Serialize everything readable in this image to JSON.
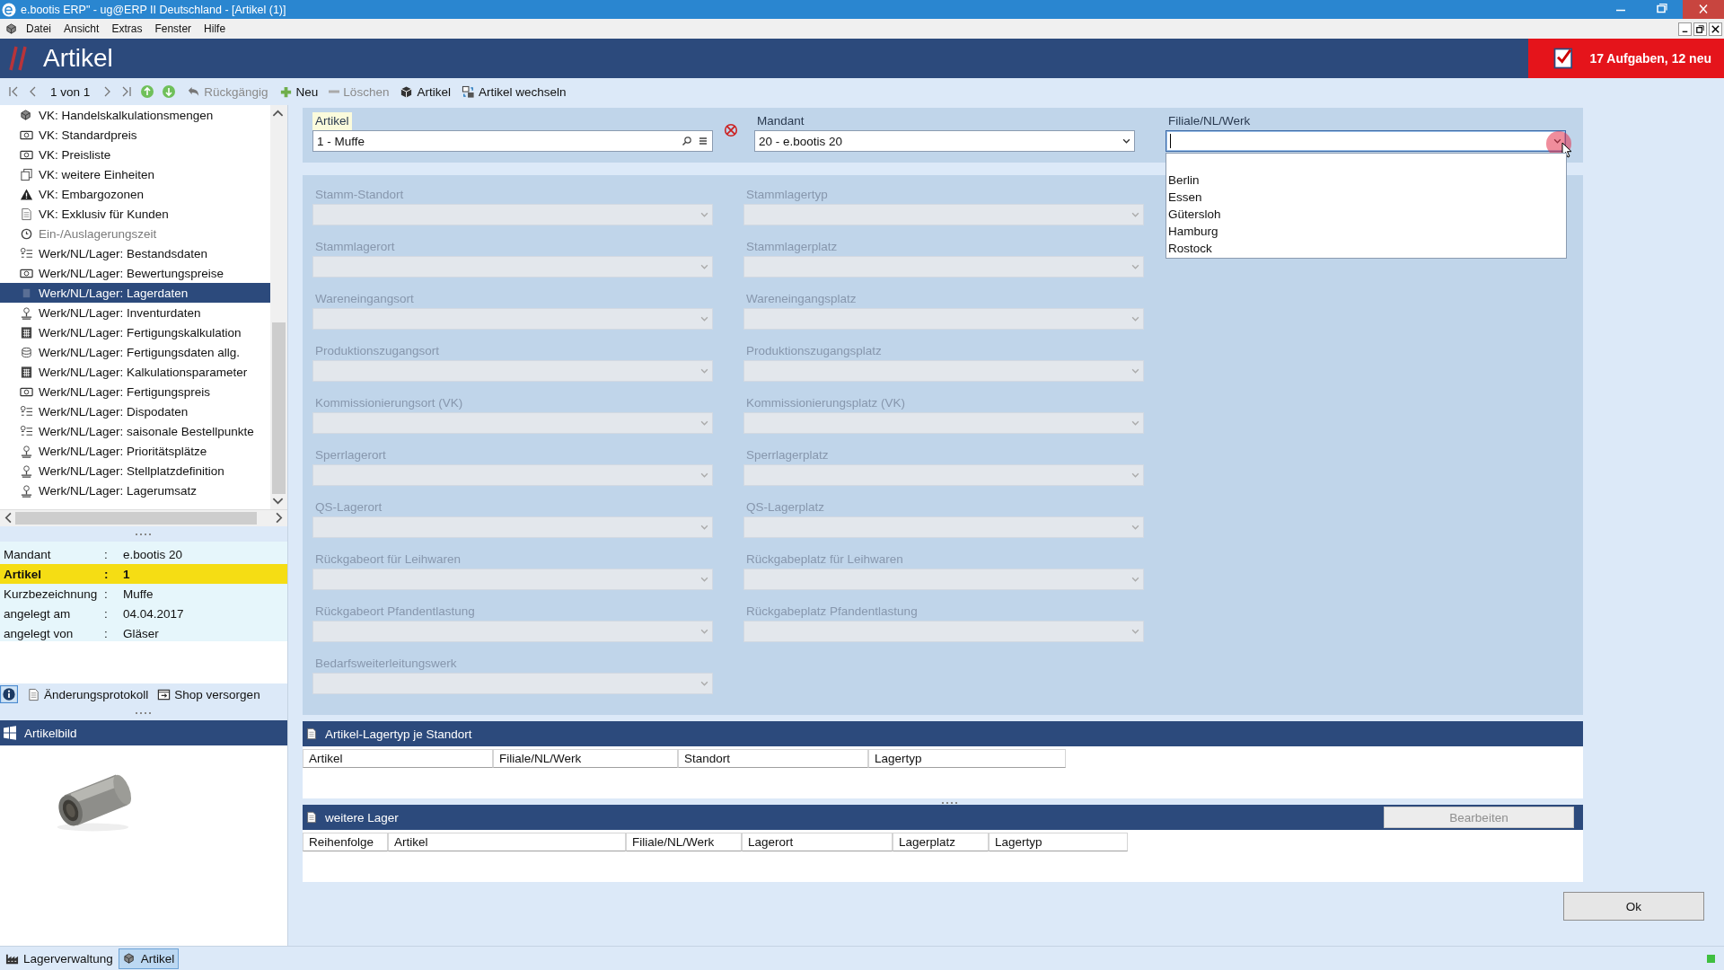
{
  "window": {
    "title": "e.bootis ERP\" - ug@ERP II Deutschland - [Artikel (1)]"
  },
  "menu": [
    "Datei",
    "Ansicht",
    "Extras",
    "Fenster",
    "Hilfe"
  ],
  "header": {
    "title": "Artikel",
    "tasks": "17 Aufgaben, 12 neu"
  },
  "toolbar": {
    "position": "1 von 1",
    "buttons": [
      {
        "kind": "undo",
        "label": "Rückgängig",
        "disabled": true
      },
      {
        "kind": "plus",
        "label": "Neu",
        "disabled": false
      },
      {
        "kind": "minus",
        "label": "Löschen",
        "disabled": true
      },
      {
        "kind": "cube",
        "label": "Artikel",
        "disabled": false
      },
      {
        "kind": "swap",
        "label": "Artikel wechseln",
        "disabled": false
      }
    ]
  },
  "tree": [
    {
      "kind": "cubes",
      "label": "VK: Handelskalkulationsmengen",
      "selected": false,
      "disabled": false
    },
    {
      "kind": "money",
      "label": "VK: Standardpreis",
      "selected": false,
      "disabled": false
    },
    {
      "kind": "money",
      "label": "VK: Preisliste",
      "selected": false,
      "disabled": false
    },
    {
      "kind": "pages",
      "label": "VK: weitere Einheiten",
      "selected": false,
      "disabled": false
    },
    {
      "kind": "warning",
      "label": "VK: Embargozonen",
      "selected": false,
      "disabled": false
    },
    {
      "kind": "document",
      "label": "VK: Exklusiv für Kunden",
      "selected": false,
      "disabled": false
    },
    {
      "kind": "clock",
      "label": "Ein-/Auslagerungszeit",
      "selected": false,
      "disabled": true
    },
    {
      "kind": "list",
      "label": "Werk/NL/Lager: Bestandsdaten",
      "selected": false,
      "disabled": false
    },
    {
      "kind": "money",
      "label": "Werk/NL/Lager: Bewertungspreise",
      "selected": false,
      "disabled": false
    },
    {
      "kind": "box",
      "label": "Werk/NL/Lager: Lagerdaten",
      "selected": true,
      "disabled": false
    },
    {
      "kind": "stack",
      "label": "Werk/NL/Lager: Inventurdaten",
      "selected": false,
      "disabled": false
    },
    {
      "kind": "calculator",
      "label": "Werk/NL/Lager: Fertigungskalkulation",
      "selected": false,
      "disabled": false
    },
    {
      "kind": "coins",
      "label": "Werk/NL/Lager: Fertigungsdaten allg.",
      "selected": false,
      "disabled": false
    },
    {
      "kind": "calculator",
      "label": "Werk/NL/Lager: Kalkulationsparameter",
      "selected": false,
      "disabled": false
    },
    {
      "kind": "money",
      "label": "Werk/NL/Lager: Fertigungspreis",
      "selected": false,
      "disabled": false
    },
    {
      "kind": "list",
      "label": "Werk/NL/Lager: Dispodaten",
      "selected": false,
      "disabled": false
    },
    {
      "kind": "list",
      "label": "Werk/NL/Lager: saisonale Bestellpunkte",
      "selected": false,
      "disabled": false
    },
    {
      "kind": "stack",
      "label": "Werk/NL/Lager: Prioritätsplätze",
      "selected": false,
      "disabled": false
    },
    {
      "kind": "stack",
      "label": "Werk/NL/Lager: Stellplatzdefinition",
      "selected": false,
      "disabled": false
    },
    {
      "kind": "stack",
      "label": "Werk/NL/Lager: Lagerumsatz",
      "selected": false,
      "disabled": false
    }
  ],
  "info": [
    {
      "label": "Mandant",
      "separator": ":",
      "value": "e.bootis 20",
      "highlighted": false
    },
    {
      "label": "Artikel",
      "separator": ":",
      "value": "1",
      "highlighted": true
    },
    {
      "label": "Kurzbezeichnung",
      "separator": ":",
      "value": "Muffe",
      "highlighted": false
    },
    {
      "label": "angelegt am",
      "separator": ":",
      "value": "04.04.2017",
      "highlighted": false
    },
    {
      "label": "angelegt von",
      "separator": ":",
      "value": "Gläser",
      "highlighted": false
    }
  ],
  "info_tools": [
    {
      "kind": "document",
      "label": "Änderungsprotokoll"
    },
    {
      "kind": "export",
      "label": "Shop versorgen"
    }
  ],
  "image_panel": {
    "title": "Artikelbild",
    "kind": "picture"
  },
  "form": {
    "artikel": {
      "label": "Artikel",
      "value": "1 - Muffe"
    },
    "mandant": {
      "label": "Mandant",
      "value": "20 - e.bootis 20"
    },
    "filiale": {
      "label": "Filiale/NL/Werk",
      "expanded": true,
      "options": [
        "Berlin",
        "Essen",
        "Gütersloh",
        "Hamburg",
        "Rostock"
      ]
    },
    "fields": [
      {
        "label": "Stamm-Standort",
        "disabled": true
      },
      {
        "label": "Stammlagertyp",
        "disabled": true
      },
      {
        "label": "Stammlagerort",
        "disabled": true
      },
      {
        "label": "Stammlagerplatz",
        "disabled": true
      },
      {
        "label": "Wareneingangsort",
        "disabled": true
      },
      {
        "label": "Wareneingangsplatz",
        "disabled": true
      },
      {
        "label": "Produktionszugangsort",
        "disabled": true
      },
      {
        "label": "Produktionszugangsplatz",
        "disabled": true
      },
      {
        "label": "Kommissionierungsort (VK)",
        "disabled": true
      },
      {
        "label": "Kommissionierungsplatz (VK)",
        "disabled": true
      },
      {
        "label": "Sperrlagerort",
        "disabled": true
      },
      {
        "label": "Sperrlagerplatz",
        "disabled": true
      },
      {
        "label": "QS-Lagerort",
        "disabled": true
      },
      {
        "label": "QS-Lagerplatz",
        "disabled": true
      },
      {
        "label": "Rückgabeort für Leihwaren",
        "disabled": true
      },
      {
        "label": "Rückgabeplatz für Leihwaren",
        "disabled": true
      },
      {
        "label": "Rückgabeort Pfandentlastung",
        "disabled": true
      },
      {
        "label": "Rückgabeplatz Pfandentlastung",
        "disabled": true
      },
      {
        "label": "Bedarfsweiterleitungswerk",
        "disabled": true
      }
    ]
  },
  "tables": [
    {
      "title": "Artikel-Lagertyp je Standort",
      "columns": [
        "Artikel",
        "Filiale/NL/Werk",
        "Standort",
        "Lagertyp"
      ]
    },
    {
      "title": "weitere Lager",
      "columns": [
        "Reihenfolge",
        "Artikel",
        "Filiale/NL/Werk",
        "Lagerort",
        "Lagerplatz",
        "Lagertyp"
      ],
      "action": {
        "label": "Bearbeiten",
        "disabled": true
      }
    }
  ],
  "ok_button": "Ok",
  "taskbar": [
    {
      "kind": "factory",
      "label": "Lagerverwaltung",
      "selected": false
    },
    {
      "kind": "cubes",
      "label": "Artikel",
      "selected": true
    }
  ]
}
